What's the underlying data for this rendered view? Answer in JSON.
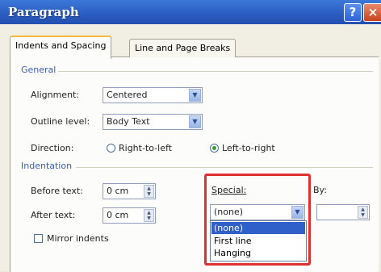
{
  "window": {
    "title": "Paragraph",
    "help_label": "?",
    "close_label": "×"
  },
  "tabs": [
    {
      "label": "Indents and Spacing",
      "active": true
    },
    {
      "label": "Line and Page Breaks",
      "active": false
    }
  ],
  "general": {
    "section_label": "General",
    "alignment": {
      "label": "Alignment:",
      "value": "Centered"
    },
    "outline_level": {
      "label": "Outline level:",
      "value": "Body Text"
    },
    "direction": {
      "label": "Direction:",
      "rtl_label": "Right-to-left",
      "ltr_label": "Left-to-right",
      "selected": "ltr"
    }
  },
  "indentation": {
    "section_label": "Indentation",
    "before": {
      "label": "Before text:",
      "value": "0 cm"
    },
    "after": {
      "label": "After text:",
      "value": "0 cm"
    },
    "mirror_label": "Mirror indents",
    "special": {
      "label": "Special:",
      "value": "(none)",
      "options": [
        "(none)",
        "First line",
        "Hanging"
      ],
      "highlighted": "(none)"
    },
    "by_label": "By:"
  },
  "colors": {
    "highlight_box": "#e03030",
    "title_bar": "#2a5cc0",
    "selection": "#2f5fc8"
  },
  "icons": [
    "help-icon",
    "close-icon",
    "dropdown-arrow-icon",
    "spin-icon"
  ]
}
